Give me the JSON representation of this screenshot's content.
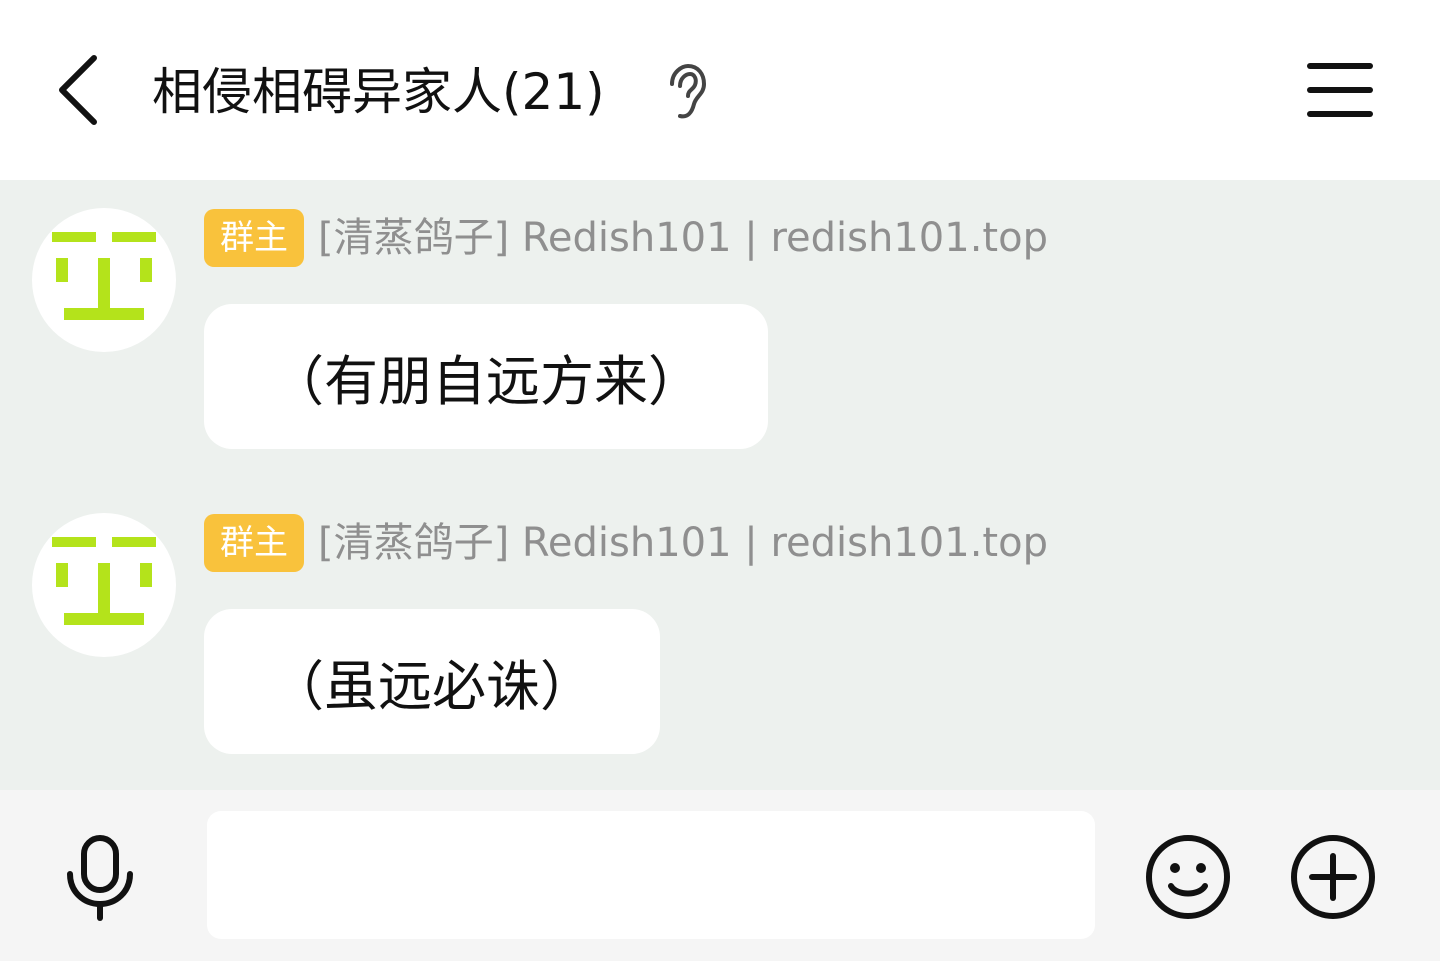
{
  "header": {
    "back_icon": "chevron-left-icon",
    "title": "相侵相碍异家人(21)",
    "status_icon": "ear-icon",
    "menu_icon": "hamburger-menu-icon"
  },
  "messages": [
    {
      "badge": "群主",
      "sender": "[清蒸鸽子] Redish101 | redish101.top",
      "text": "（有朋自远方来）",
      "avatar_icon": "pixel-face-avatar"
    },
    {
      "badge": "群主",
      "sender": "[清蒸鸽子] Redish101 | redish101.top",
      "text": "（虽远必诛）",
      "avatar_icon": "pixel-face-avatar"
    }
  ],
  "input_bar": {
    "voice_icon": "microphone-icon",
    "message_value": "",
    "emoji_icon": "smiley-icon",
    "more_icon": "plus-circle-icon"
  },
  "colors": {
    "chat_background": "#edf1ee",
    "badge": "#f9c23c",
    "avatar_accent": "#b4e31b",
    "sender_text": "#8f8f8f"
  }
}
